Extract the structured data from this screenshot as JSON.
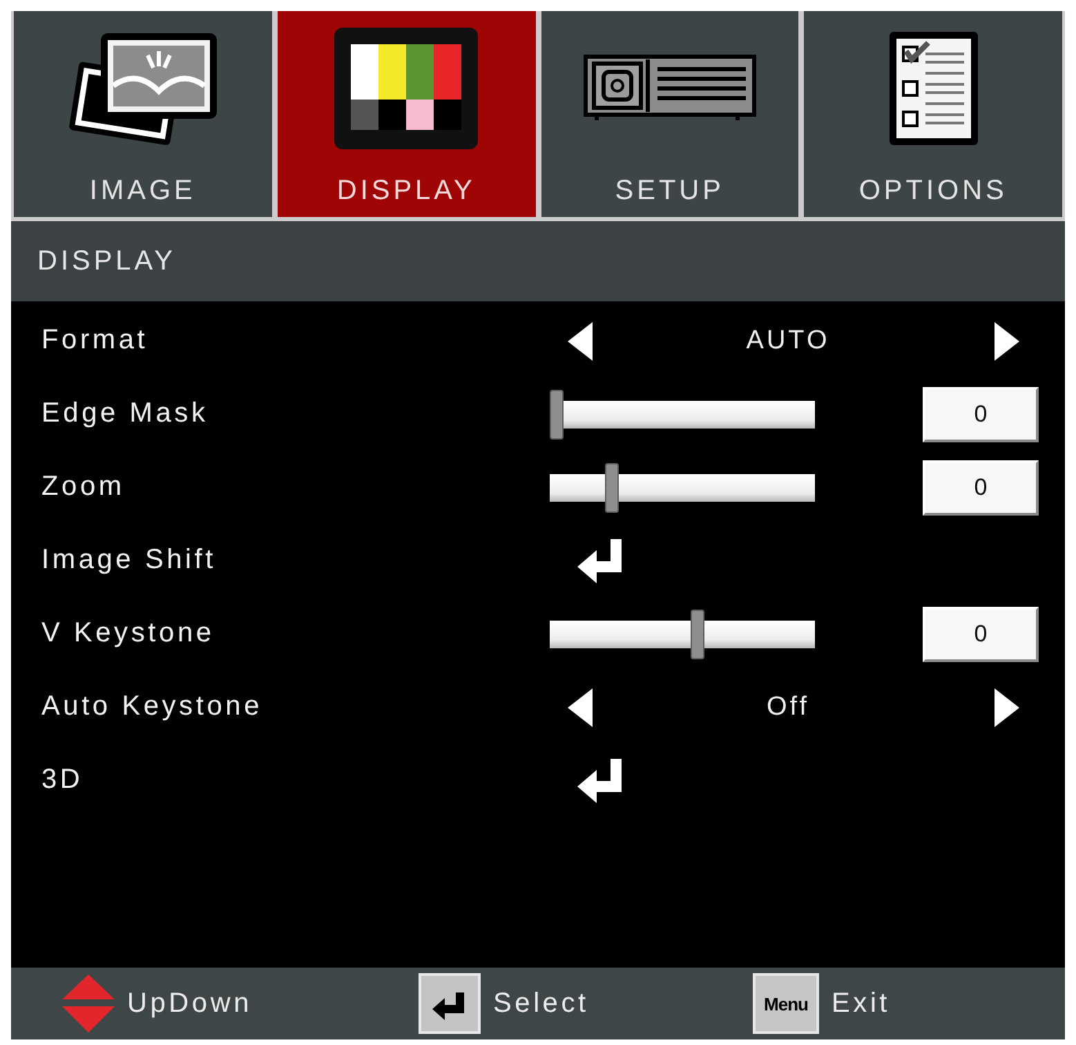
{
  "tabs": [
    {
      "label": "IMAGE",
      "selected": false
    },
    {
      "label": "DISPLAY",
      "selected": true
    },
    {
      "label": "SETUP",
      "selected": false
    },
    {
      "label": "OPTIONS",
      "selected": false
    }
  ],
  "section_title": "DISPLAY",
  "settings": [
    {
      "kind": "choice",
      "label": "Format",
      "value": "AUTO"
    },
    {
      "kind": "slider",
      "label": "Edge Mask",
      "level": 0,
      "value": "0"
    },
    {
      "kind": "slider",
      "label": "Zoom",
      "level": 0.22,
      "value": "0"
    },
    {
      "kind": "submenu",
      "label": "Image Shift"
    },
    {
      "kind": "slider",
      "label": "V Keystone",
      "level": 0.56,
      "value": "0"
    },
    {
      "kind": "choice",
      "label": "Auto Keystone",
      "value": "Off"
    },
    {
      "kind": "submenu",
      "label": "3D"
    }
  ],
  "footer": [
    {
      "kind": "arrows",
      "action": "UpDown"
    },
    {
      "kind": "enter",
      "action": "Select"
    },
    {
      "kind": "keycap",
      "key": "Menu",
      "action": "Exit"
    }
  ]
}
